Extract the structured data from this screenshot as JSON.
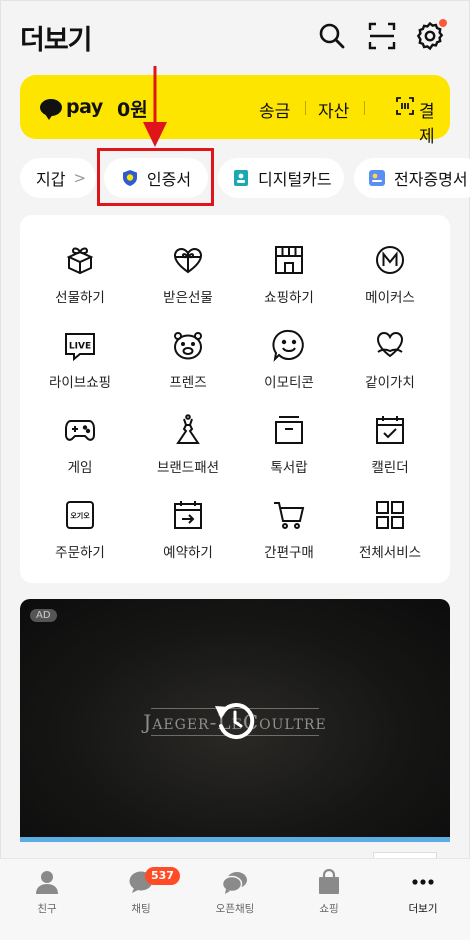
{
  "header": {
    "title": "더보기",
    "icons": [
      "search-icon",
      "scan-icon",
      "gear-icon"
    ]
  },
  "pay": {
    "brand": "pay",
    "amount": "0원",
    "links": [
      "송금",
      "자산",
      "결제"
    ],
    "color": "#fee500"
  },
  "chips": {
    "wallet": "지갑",
    "wallet_arrow": ">",
    "cert": "인증서",
    "card": "디지털카드",
    "doc": "전자증명서"
  },
  "services": [
    {
      "label": "선물하기",
      "icon": "gift-box-icon"
    },
    {
      "label": "받은선물",
      "icon": "heart-gift-icon"
    },
    {
      "label": "쇼핑하기",
      "icon": "store-icon"
    },
    {
      "label": "메이커스",
      "icon": "makers-icon"
    },
    {
      "label": "라이브쇼핑",
      "icon": "live-icon"
    },
    {
      "label": "프렌즈",
      "icon": "friends-icon"
    },
    {
      "label": "이모티콘",
      "icon": "emoticon-icon"
    },
    {
      "label": "같이가치",
      "icon": "together-heart-icon"
    },
    {
      "label": "게임",
      "icon": "gamepad-icon"
    },
    {
      "label": "브랜드패션",
      "icon": "dress-icon"
    },
    {
      "label": "톡서랍",
      "icon": "drawer-icon"
    },
    {
      "label": "캘린더",
      "icon": "calendar-icon"
    },
    {
      "label": "주문하기",
      "icon": "order-icon"
    },
    {
      "label": "예약하기",
      "icon": "reservation-icon"
    },
    {
      "label": "간편구매",
      "icon": "cart-icon"
    },
    {
      "label": "전체서비스",
      "icon": "grid-icon"
    }
  ],
  "order_icon_text": "오기오",
  "ad": {
    "badge": "AD",
    "brand": "Jaeger-LeCoultre"
  },
  "nav": [
    {
      "label": "친구",
      "icon": "person-icon"
    },
    {
      "label": "채팅",
      "icon": "chat-icon",
      "badge": "537"
    },
    {
      "label": "오픈채팅",
      "icon": "open-chat-icon"
    },
    {
      "label": "쇼핑",
      "icon": "shopping-bag-icon"
    },
    {
      "label": "더보기",
      "icon": "more-icon",
      "active": true
    }
  ],
  "colors": {
    "highlight": "#e0151b",
    "badge": "#ff4b26",
    "cert_shield": "#2f5bd3"
  }
}
